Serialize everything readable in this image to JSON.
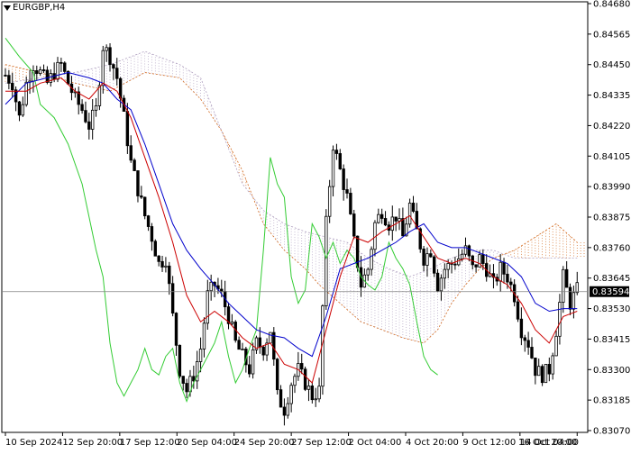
{
  "chart_data": {
    "type": "candlestick",
    "symbol": "EURGBP,H4",
    "current_price": "0.83594",
    "ylim": [
      0.8307,
      0.8468
    ],
    "y_ticks": [
      "0.84680",
      "0.84565",
      "0.84450",
      "0.84335",
      "0.84220",
      "0.84105",
      "0.83990",
      "0.83875",
      "0.83760",
      "0.83645",
      "0.83530",
      "0.83415",
      "0.83300",
      "0.83185",
      "0.83070"
    ],
    "x_ticks": [
      "10 Sep 2024",
      "12 Sep 20:00",
      "17 Sep 12:00",
      "20 Sep 04:00",
      "24 Sep 20:00",
      "27 Sep 12:00",
      "2 Oct 04:00",
      "4 Oct 20:00",
      "9 Oct 12:00",
      "14 Oct 04:00",
      "16 Oct 20:00"
    ],
    "close_path": [
      [
        0,
        0.8441
      ],
      [
        2,
        0.8438
      ],
      [
        4,
        0.8425
      ],
      [
        6,
        0.8438
      ],
      [
        8,
        0.8445
      ],
      [
        10,
        0.8442
      ],
      [
        12,
        0.8438
      ],
      [
        14,
        0.8442
      ],
      [
        16,
        0.8445
      ],
      [
        18,
        0.8438
      ],
      [
        20,
        0.8432
      ],
      [
        22,
        0.8428
      ],
      [
        24,
        0.8422
      ],
      [
        26,
        0.8428
      ],
      [
        28,
        0.8452
      ],
      [
        30,
        0.8448
      ],
      [
        32,
        0.844
      ],
      [
        34,
        0.8425
      ],
      [
        36,
        0.8408
      ],
      [
        38,
        0.8398
      ],
      [
        40,
        0.8388
      ],
      [
        42,
        0.838
      ],
      [
        44,
        0.837
      ],
      [
        46,
        0.8372
      ],
      [
        48,
        0.835
      ],
      [
        50,
        0.833
      ],
      [
        52,
        0.8322
      ],
      [
        54,
        0.8328
      ],
      [
        56,
        0.8338
      ],
      [
        58,
        0.8358
      ],
      [
        60,
        0.8362
      ],
      [
        62,
        0.8358
      ],
      [
        64,
        0.835
      ],
      [
        66,
        0.834
      ],
      [
        68,
        0.8335
      ],
      [
        70,
        0.833
      ],
      [
        72,
        0.834
      ],
      [
        74,
        0.8338
      ],
      [
        76,
        0.8345
      ],
      [
        78,
        0.832
      ],
      [
        80,
        0.8315
      ],
      [
        82,
        0.8325
      ],
      [
        84,
        0.833
      ],
      [
        86,
        0.8325
      ],
      [
        88,
        0.832
      ],
      [
        90,
        0.8322
      ],
      [
        92,
        0.8385
      ],
      [
        94,
        0.8415
      ],
      [
        96,
        0.8405
      ],
      [
        98,
        0.8395
      ],
      [
        100,
        0.8378
      ],
      [
        102,
        0.8362
      ],
      [
        104,
        0.8368
      ],
      [
        106,
        0.8385
      ],
      [
        108,
        0.839
      ],
      [
        110,
        0.8385
      ],
      [
        112,
        0.8388
      ],
      [
        114,
        0.838
      ],
      [
        116,
        0.8392
      ],
      [
        118,
        0.8382
      ],
      [
        120,
        0.8372
      ],
      [
        122,
        0.8375
      ],
      [
        124,
        0.8362
      ],
      [
        126,
        0.8368
      ],
      [
        128,
        0.837
      ],
      [
        130,
        0.8372
      ],
      [
        132,
        0.8375
      ],
      [
        134,
        0.8368
      ],
      [
        136,
        0.8372
      ],
      [
        138,
        0.8368
      ],
      [
        140,
        0.8362
      ],
      [
        142,
        0.8368
      ],
      [
        144,
        0.8365
      ],
      [
        146,
        0.8358
      ],
      [
        148,
        0.8345
      ],
      [
        150,
        0.834
      ],
      [
        152,
        0.833
      ],
      [
        154,
        0.8328
      ],
      [
        156,
        0.833
      ],
      [
        158,
        0.8345
      ],
      [
        160,
        0.8365
      ],
      [
        162,
        0.8355
      ],
      [
        164,
        0.836
      ]
    ],
    "tenkan_line": [
      [
        0,
        0.8435
      ],
      [
        6,
        0.8435
      ],
      [
        10,
        0.8438
      ],
      [
        16,
        0.844
      ],
      [
        20,
        0.8435
      ],
      [
        24,
        0.8432
      ],
      [
        28,
        0.8438
      ],
      [
        32,
        0.8435
      ],
      [
        36,
        0.8425
      ],
      [
        40,
        0.841
      ],
      [
        44,
        0.8395
      ],
      [
        48,
        0.8378
      ],
      [
        52,
        0.8358
      ],
      [
        56,
        0.8348
      ],
      [
        60,
        0.8352
      ],
      [
        64,
        0.8348
      ],
      [
        68,
        0.8342
      ],
      [
        72,
        0.8338
      ],
      [
        76,
        0.834
      ],
      [
        80,
        0.8332
      ],
      [
        84,
        0.833
      ],
      [
        88,
        0.8325
      ],
      [
        92,
        0.8345
      ],
      [
        96,
        0.8365
      ],
      [
        100,
        0.838
      ],
      [
        104,
        0.8378
      ],
      [
        108,
        0.8382
      ],
      [
        112,
        0.8385
      ],
      [
        116,
        0.8388
      ],
      [
        120,
        0.838
      ],
      [
        124,
        0.8372
      ],
      [
        128,
        0.837
      ],
      [
        132,
        0.8372
      ],
      [
        136,
        0.837
      ],
      [
        140,
        0.8365
      ],
      [
        144,
        0.8362
      ],
      [
        148,
        0.8355
      ],
      [
        152,
        0.8345
      ],
      [
        156,
        0.834
      ],
      [
        160,
        0.835
      ],
      [
        164,
        0.8352
      ]
    ],
    "kijun_line": [
      [
        0,
        0.843
      ],
      [
        6,
        0.8438
      ],
      [
        12,
        0.844
      ],
      [
        18,
        0.8442
      ],
      [
        24,
        0.844
      ],
      [
        28,
        0.8438
      ],
      [
        32,
        0.8432
      ],
      [
        36,
        0.8428
      ],
      [
        40,
        0.8415
      ],
      [
        44,
        0.84
      ],
      [
        48,
        0.8385
      ],
      [
        52,
        0.8375
      ],
      [
        56,
        0.8368
      ],
      [
        60,
        0.8362
      ],
      [
        64,
        0.8355
      ],
      [
        68,
        0.835
      ],
      [
        72,
        0.8345
      ],
      [
        76,
        0.8343
      ],
      [
        80,
        0.8342
      ],
      [
        84,
        0.8338
      ],
      [
        88,
        0.8335
      ],
      [
        92,
        0.835
      ],
      [
        96,
        0.8368
      ],
      [
        100,
        0.837
      ],
      [
        104,
        0.8372
      ],
      [
        108,
        0.8375
      ],
      [
        112,
        0.8378
      ],
      [
        116,
        0.8382
      ],
      [
        120,
        0.8385
      ],
      [
        124,
        0.8378
      ],
      [
        128,
        0.8376
      ],
      [
        132,
        0.8376
      ],
      [
        136,
        0.8374
      ],
      [
        140,
        0.8372
      ],
      [
        144,
        0.837
      ],
      [
        148,
        0.8365
      ],
      [
        152,
        0.8355
      ],
      [
        156,
        0.8352
      ],
      [
        160,
        0.8353
      ],
      [
        164,
        0.8353
      ]
    ],
    "chikou_line": [
      [
        0,
        0.8455
      ],
      [
        4,
        0.8448
      ],
      [
        8,
        0.8442
      ],
      [
        10,
        0.843
      ],
      [
        14,
        0.8425
      ],
      [
        18,
        0.8415
      ],
      [
        22,
        0.84
      ],
      [
        26,
        0.8375
      ],
      [
        28,
        0.8365
      ],
      [
        30,
        0.834
      ],
      [
        32,
        0.8325
      ],
      [
        34,
        0.832
      ],
      [
        36,
        0.8325
      ],
      [
        38,
        0.833
      ],
      [
        40,
        0.8338
      ],
      [
        42,
        0.833
      ],
      [
        44,
        0.8328
      ],
      [
        46,
        0.8335
      ],
      [
        48,
        0.8338
      ],
      [
        50,
        0.8325
      ],
      [
        52,
        0.8318
      ],
      [
        54,
        0.8325
      ],
      [
        56,
        0.833
      ],
      [
        58,
        0.8335
      ],
      [
        60,
        0.834
      ],
      [
        62,
        0.8348
      ],
      [
        64,
        0.8335
      ],
      [
        66,
        0.8325
      ],
      [
        68,
        0.833
      ],
      [
        70,
        0.8338
      ],
      [
        72,
        0.8345
      ],
      [
        74,
        0.8375
      ],
      [
        76,
        0.841
      ],
      [
        78,
        0.84
      ],
      [
        80,
        0.8395
      ],
      [
        82,
        0.8365
      ],
      [
        84,
        0.8355
      ],
      [
        86,
        0.836
      ],
      [
        88,
        0.8385
      ],
      [
        90,
        0.838
      ],
      [
        92,
        0.8372
      ],
      [
        94,
        0.8378
      ],
      [
        96,
        0.837
      ],
      [
        98,
        0.8375
      ],
      [
        100,
        0.8372
      ],
      [
        102,
        0.8365
      ],
      [
        104,
        0.8362
      ],
      [
        106,
        0.836
      ],
      [
        108,
        0.8365
      ],
      [
        110,
        0.8378
      ],
      [
        112,
        0.8372
      ],
      [
        114,
        0.8368
      ],
      [
        116,
        0.8362
      ],
      [
        118,
        0.8348
      ],
      [
        120,
        0.8335
      ],
      [
        122,
        0.833
      ],
      [
        124,
        0.8328
      ]
    ],
    "senkou_a": [
      [
        0,
        0.8445
      ],
      [
        10,
        0.8442
      ],
      [
        20,
        0.8438
      ],
      [
        30,
        0.8435
      ],
      [
        40,
        0.8442
      ],
      [
        50,
        0.844
      ],
      [
        56,
        0.8432
      ],
      [
        62,
        0.842
      ],
      [
        68,
        0.8405
      ],
      [
        74,
        0.8385
      ],
      [
        80,
        0.8375
      ],
      [
        86,
        0.8368
      ],
      [
        90,
        0.8362
      ],
      [
        96,
        0.8355
      ],
      [
        102,
        0.8348
      ],
      [
        108,
        0.8345
      ],
      [
        114,
        0.8342
      ],
      [
        120,
        0.834
      ],
      [
        124,
        0.8345
      ],
      [
        128,
        0.8355
      ],
      [
        132,
        0.8362
      ],
      [
        136,
        0.8368
      ],
      [
        140,
        0.8372
      ],
      [
        146,
        0.8375
      ],
      [
        152,
        0.838
      ],
      [
        158,
        0.8385
      ],
      [
        164,
        0.8378
      ]
    ],
    "senkou_b": [
      [
        0,
        0.8438
      ],
      [
        10,
        0.844
      ],
      [
        20,
        0.8442
      ],
      [
        30,
        0.8445
      ],
      [
        40,
        0.845
      ],
      [
        50,
        0.8445
      ],
      [
        56,
        0.844
      ],
      [
        62,
        0.842
      ],
      [
        68,
        0.84
      ],
      [
        74,
        0.839
      ],
      [
        80,
        0.8385
      ],
      [
        86,
        0.8382
      ],
      [
        92,
        0.838
      ],
      [
        98,
        0.8378
      ],
      [
        104,
        0.8372
      ],
      [
        110,
        0.8368
      ],
      [
        116,
        0.8365
      ],
      [
        122,
        0.8368
      ],
      [
        128,
        0.8372
      ],
      [
        134,
        0.8375
      ],
      [
        140,
        0.8375
      ],
      [
        146,
        0.8372
      ],
      [
        152,
        0.8372
      ],
      [
        158,
        0.8372
      ],
      [
        164,
        0.8372
      ]
    ],
    "grid": false,
    "colors": {
      "bull_fill": "#ffffff",
      "bear_fill": "#000000",
      "candle_outline": "#000000",
      "tenkan": "#cc0000",
      "kijun": "#0000cc",
      "chikou": "#33cc33",
      "senkou_a": "#d2691e",
      "senkou_b": "#b0a0c0",
      "price_line": "#808080",
      "price_label_bg": "#000000",
      "price_label_text": "#ffffff"
    }
  }
}
